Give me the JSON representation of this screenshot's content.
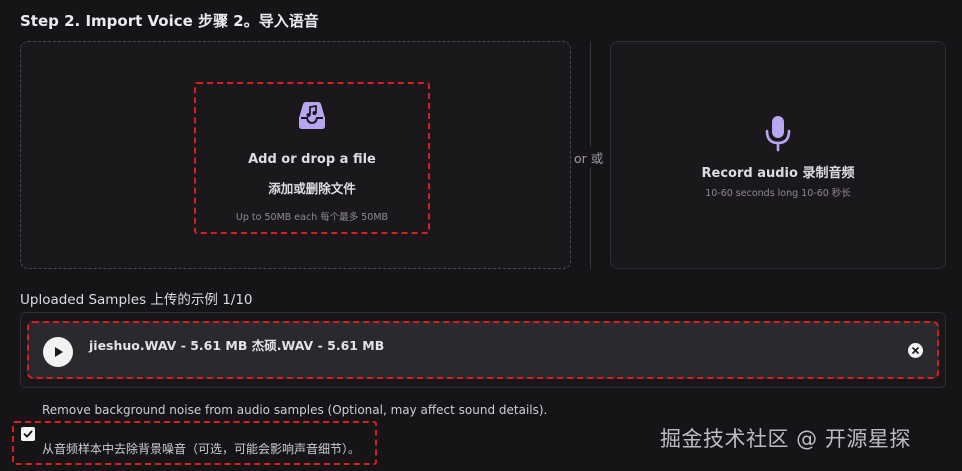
{
  "step": {
    "title": "Step 2. Import Voice 步骤 2。导入语音"
  },
  "upload": {
    "icon": "inbox-music-icon",
    "line1": "Add or drop a file",
    "line2": "添加或删除文件",
    "limit": "Up to 50MB each 每个最多 50MB"
  },
  "separator": {
    "label": "or 或"
  },
  "record": {
    "icon": "microphone-icon",
    "label": "Record audio 录制音频",
    "hint": "10-60 seconds long 10-60 秒长"
  },
  "samples": {
    "title": "Uploaded Samples 上传的示例  1/10",
    "items": [
      {
        "name": "jieshuo.WAV - 5.61 MB 杰硕.WAV - 5.61 MB"
      }
    ]
  },
  "noise": {
    "label_en": "Remove background noise from audio samples (Optional, may affect sound details).",
    "label_cn": "从音频样本中去除背景噪音（可选，可能会影响声音细节）。",
    "checked": true
  },
  "watermark": "掘金技术社区 @ 开源星探",
  "colors": {
    "accent": "#b7a6f2",
    "highlight": "#d71f1f",
    "background": "#171417"
  }
}
